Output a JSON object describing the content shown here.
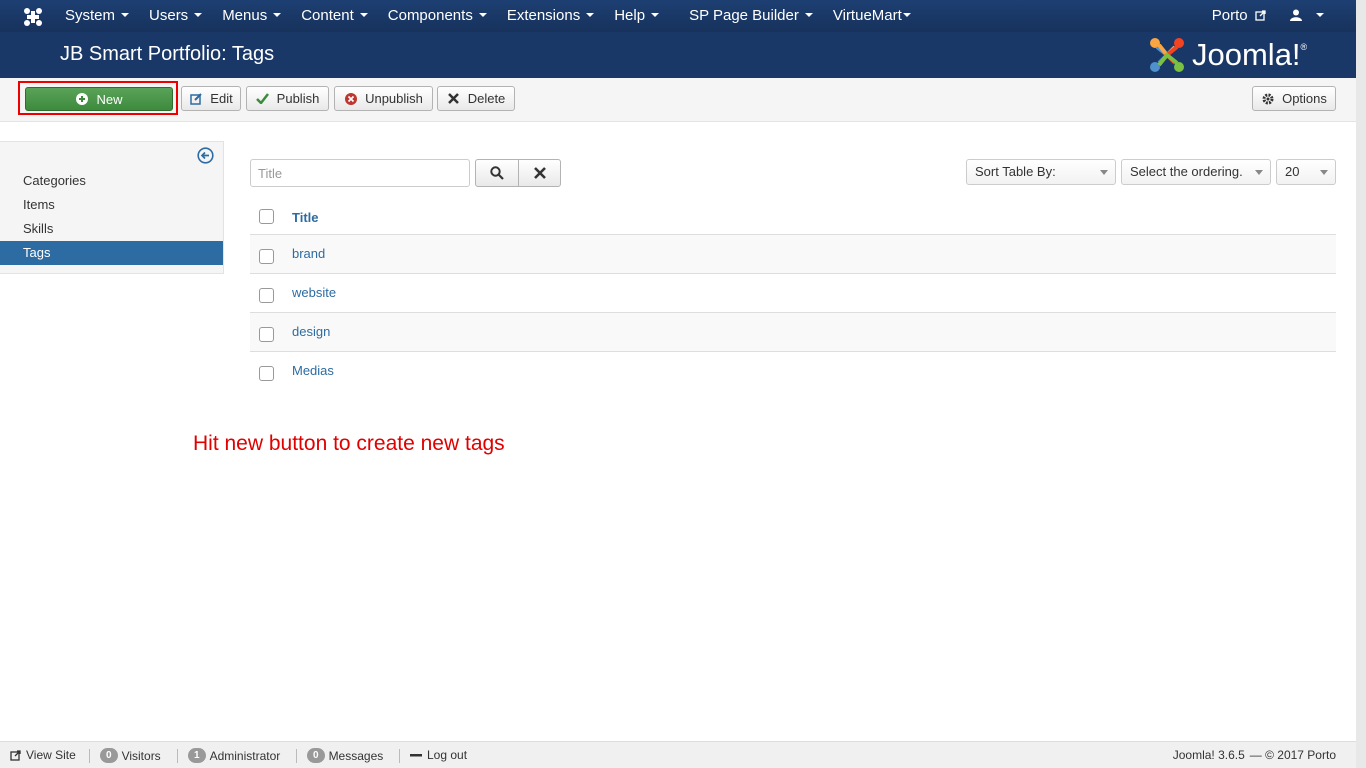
{
  "navbar": {
    "menu": [
      {
        "label": "System",
        "caret": true
      },
      {
        "label": "Users",
        "caret": true
      },
      {
        "label": "Menus",
        "caret": true
      },
      {
        "label": "Content",
        "caret": true
      },
      {
        "label": "Components",
        "caret": true
      },
      {
        "label": "Extensions",
        "caret": true
      },
      {
        "label": "Help",
        "caret": true
      },
      {
        "label": "SP Page Builder",
        "caret": true
      },
      {
        "label": "VirtueMart",
        "caret": true
      }
    ],
    "site_link": "Porto",
    "user_icon": "user-icon"
  },
  "header": {
    "title": "JB Smart Portfolio: Tags",
    "logo_text": "Joomla!",
    "logo_reg": "®"
  },
  "toolbar": {
    "new_label": "New",
    "edit_label": "Edit",
    "publish_label": "Publish",
    "unpublish_label": "Unpublish",
    "delete_label": "Delete",
    "options_label": "Options"
  },
  "sidebar": {
    "items": [
      {
        "label": "Categories",
        "active": false
      },
      {
        "label": "Items",
        "active": false
      },
      {
        "label": "Skills",
        "active": false
      },
      {
        "label": "Tags",
        "active": true
      }
    ]
  },
  "filters": {
    "search_placeholder": "Title",
    "search_value": "",
    "sort_label": "Sort Table By:",
    "ordering_label": "Select the ordering.",
    "limit_value": "20"
  },
  "table": {
    "header_title": "Title",
    "rows": [
      "brand",
      "website",
      "design",
      "Medias"
    ]
  },
  "annotation": "Hit new button to create new tags",
  "statusbar": {
    "view_site": "View Site",
    "visitors_count": "0",
    "visitors_label": "Visitors",
    "admin_count": "1",
    "admin_label": "Administrator",
    "messages_count": "0",
    "messages_label": "Messages",
    "logout_label": "Log out",
    "version": "Joomla! 3.6.5",
    "copyright": "— © 2017 Porto"
  },
  "colors": {
    "navbar": "#1a3867",
    "accent": "#2d6ca2",
    "new_button": "#46964a",
    "annotation": "#e00000"
  }
}
